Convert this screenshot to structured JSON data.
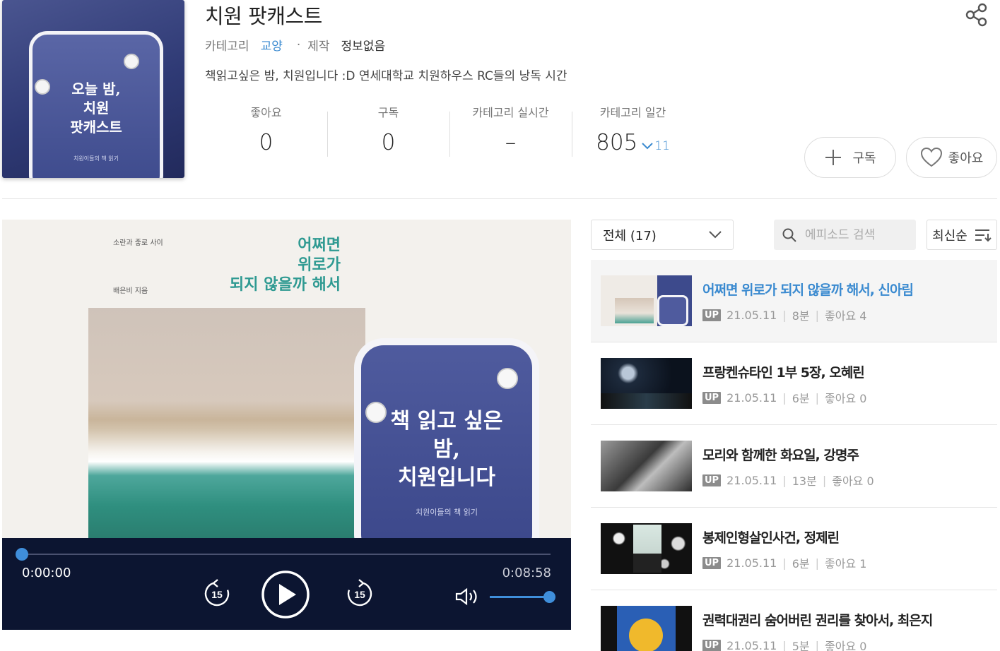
{
  "podcast": {
    "title": "치원 팟캐스트",
    "category_label": "카테고리",
    "category_value": "교양",
    "producer_label": "제작",
    "producer_value": "정보없음",
    "description": "책읽고싶은 밤, 치원입니다 :D 연세대학교 치원하우스 RC들의 낭독 시간"
  },
  "cover_art": {
    "title": "오늘 밤, 치원 팟캐스트",
    "line1": "오늘 밤,",
    "line2": "치원",
    "line3": "팟캐스트",
    "subtitle": "치원이들의 책 읽기"
  },
  "stats": [
    {
      "label": "좋아요",
      "value": "0"
    },
    {
      "label": "구독",
      "value": "0"
    },
    {
      "label": "카테고리 실시간",
      "value": "–"
    },
    {
      "label": "카테고리 일간",
      "value": "805",
      "change": "11",
      "change_direction": "down"
    }
  ],
  "actions": {
    "subscribe_label": "구독",
    "like_label": "좋아요"
  },
  "player": {
    "artwork": {
      "publisher": "소란과 좋로 사이",
      "author": "배은비 지음",
      "book_title_line1": "어쩌면",
      "book_title_line2": "위로가",
      "book_title_line3": "되지 않을까 해서",
      "phone_line1": "책 읽고 싶은",
      "phone_line2": "밤,",
      "phone_line3": "치원입니다",
      "phone_sub": "치원이들의 책 읽기"
    },
    "current_time": "0:00:00",
    "total_time": "0:08:58",
    "progress": 0.0,
    "skip_seconds": "15",
    "volume": 1.0
  },
  "episode_list": {
    "filter_selected": "전체 (17)",
    "search_placeholder": "에피소드 검색",
    "sort_label": "최신순",
    "episodes": [
      {
        "title": "어쩌면 위로가 되지 않을까 해서, 신아림",
        "badge": "UP",
        "date": "21.05.11",
        "duration": "8분",
        "likes": "좋아요 4",
        "active": true
      },
      {
        "title": "프랑켄슈타인 1부 5장, 오혜린",
        "badge": "UP",
        "date": "21.05.11",
        "duration": "6분",
        "likes": "좋아요 0",
        "active": false
      },
      {
        "title": "모리와 함께한 화요일, 강명주",
        "badge": "UP",
        "date": "21.05.11",
        "duration": "13분",
        "likes": "좋아요 0",
        "active": false
      },
      {
        "title": "봉제인형살인사건, 정제린",
        "badge": "UP",
        "date": "21.05.11",
        "duration": "6분",
        "likes": "좋아요 1",
        "active": false
      },
      {
        "title": "권력대권리 숨어버린 권리를 찾아서, 최은지",
        "badge": "UP",
        "date": "21.05.11",
        "duration": "5분",
        "likes": "좋아요 0",
        "active": false
      }
    ]
  },
  "colors": {
    "accent": "#3a8ad0",
    "player_bar": "#0c1531",
    "progress": "#3f8edb"
  }
}
